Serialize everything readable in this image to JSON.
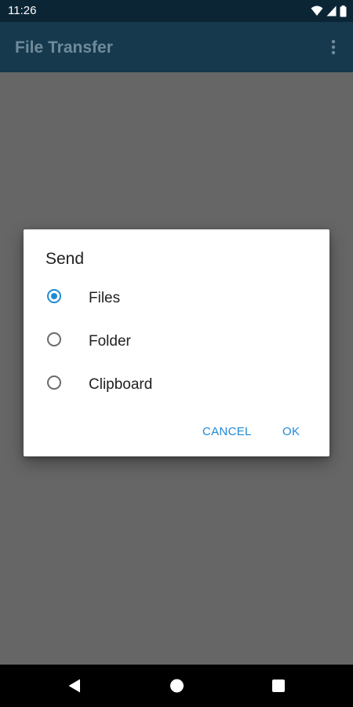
{
  "status_bar": {
    "time": "11:26",
    "icons": [
      "wifi-icon",
      "signal-icon",
      "battery-icon"
    ]
  },
  "app_bar": {
    "title": "File Transfer",
    "menu_icon": "more-vert-icon"
  },
  "dialog": {
    "title": "Send",
    "options": [
      {
        "label": "Files",
        "selected": true
      },
      {
        "label": "Folder",
        "selected": false
      },
      {
        "label": "Clipboard",
        "selected": false
      }
    ],
    "cancel_label": "CANCEL",
    "ok_label": "OK"
  },
  "nav_bar": {
    "buttons": [
      "back-icon",
      "home-icon",
      "recents-icon"
    ]
  },
  "colors": {
    "accent": "#1e8ad6",
    "app_bar": "#16394d",
    "status_bar": "#0c2535",
    "scrim": "#666666"
  }
}
